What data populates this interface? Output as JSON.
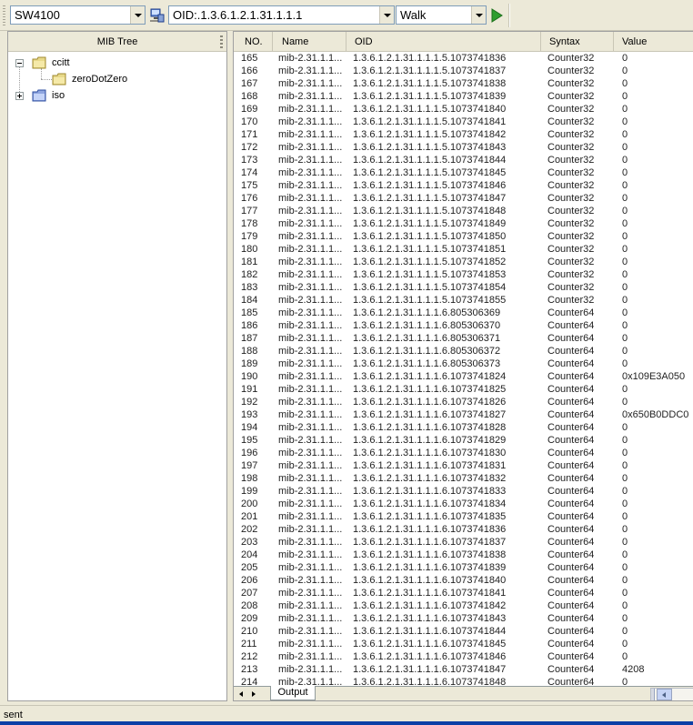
{
  "toolbar": {
    "device": "SW4100",
    "oid": "OID:.1.3.6.1.2.1.31.1.1.1",
    "operation": "Walk"
  },
  "mib_tree": {
    "title": "MIB Tree",
    "nodes": [
      {
        "label": "ccitt"
      },
      {
        "label": "zeroDotZero"
      },
      {
        "label": "iso"
      }
    ]
  },
  "grid": {
    "columns": [
      "NO.",
      "Name",
      "OID",
      "Syntax",
      "Value"
    ],
    "rows": [
      [
        "165",
        "mib-2.31.1.1...",
        "1.3.6.1.2.1.31.1.1.1.5.1073741836",
        "Counter32",
        "0"
      ],
      [
        "166",
        "mib-2.31.1.1...",
        "1.3.6.1.2.1.31.1.1.1.5.1073741837",
        "Counter32",
        "0"
      ],
      [
        "167",
        "mib-2.31.1.1...",
        "1.3.6.1.2.1.31.1.1.1.5.1073741838",
        "Counter32",
        "0"
      ],
      [
        "168",
        "mib-2.31.1.1...",
        "1.3.6.1.2.1.31.1.1.1.5.1073741839",
        "Counter32",
        "0"
      ],
      [
        "169",
        "mib-2.31.1.1...",
        "1.3.6.1.2.1.31.1.1.1.5.1073741840",
        "Counter32",
        "0"
      ],
      [
        "170",
        "mib-2.31.1.1...",
        "1.3.6.1.2.1.31.1.1.1.5.1073741841",
        "Counter32",
        "0"
      ],
      [
        "171",
        "mib-2.31.1.1...",
        "1.3.6.1.2.1.31.1.1.1.5.1073741842",
        "Counter32",
        "0"
      ],
      [
        "172",
        "mib-2.31.1.1...",
        "1.3.6.1.2.1.31.1.1.1.5.1073741843",
        "Counter32",
        "0"
      ],
      [
        "173",
        "mib-2.31.1.1...",
        "1.3.6.1.2.1.31.1.1.1.5.1073741844",
        "Counter32",
        "0"
      ],
      [
        "174",
        "mib-2.31.1.1...",
        "1.3.6.1.2.1.31.1.1.1.5.1073741845",
        "Counter32",
        "0"
      ],
      [
        "175",
        "mib-2.31.1.1...",
        "1.3.6.1.2.1.31.1.1.1.5.1073741846",
        "Counter32",
        "0"
      ],
      [
        "176",
        "mib-2.31.1.1...",
        "1.3.6.1.2.1.31.1.1.1.5.1073741847",
        "Counter32",
        "0"
      ],
      [
        "177",
        "mib-2.31.1.1...",
        "1.3.6.1.2.1.31.1.1.1.5.1073741848",
        "Counter32",
        "0"
      ],
      [
        "178",
        "mib-2.31.1.1...",
        "1.3.6.1.2.1.31.1.1.1.5.1073741849",
        "Counter32",
        "0"
      ],
      [
        "179",
        "mib-2.31.1.1...",
        "1.3.6.1.2.1.31.1.1.1.5.1073741850",
        "Counter32",
        "0"
      ],
      [
        "180",
        "mib-2.31.1.1...",
        "1.3.6.1.2.1.31.1.1.1.5.1073741851",
        "Counter32",
        "0"
      ],
      [
        "181",
        "mib-2.31.1.1...",
        "1.3.6.1.2.1.31.1.1.1.5.1073741852",
        "Counter32",
        "0"
      ],
      [
        "182",
        "mib-2.31.1.1...",
        "1.3.6.1.2.1.31.1.1.1.5.1073741853",
        "Counter32",
        "0"
      ],
      [
        "183",
        "mib-2.31.1.1...",
        "1.3.6.1.2.1.31.1.1.1.5.1073741854",
        "Counter32",
        "0"
      ],
      [
        "184",
        "mib-2.31.1.1...",
        "1.3.6.1.2.1.31.1.1.1.5.1073741855",
        "Counter32",
        "0"
      ],
      [
        "185",
        "mib-2.31.1.1...",
        "1.3.6.1.2.1.31.1.1.1.6.805306369",
        "Counter64",
        "0"
      ],
      [
        "186",
        "mib-2.31.1.1...",
        "1.3.6.1.2.1.31.1.1.1.6.805306370",
        "Counter64",
        "0"
      ],
      [
        "187",
        "mib-2.31.1.1...",
        "1.3.6.1.2.1.31.1.1.1.6.805306371",
        "Counter64",
        "0"
      ],
      [
        "188",
        "mib-2.31.1.1...",
        "1.3.6.1.2.1.31.1.1.1.6.805306372",
        "Counter64",
        "0"
      ],
      [
        "189",
        "mib-2.31.1.1...",
        "1.3.6.1.2.1.31.1.1.1.6.805306373",
        "Counter64",
        "0"
      ],
      [
        "190",
        "mib-2.31.1.1...",
        "1.3.6.1.2.1.31.1.1.1.6.1073741824",
        "Counter64",
        "0x109E3A050"
      ],
      [
        "191",
        "mib-2.31.1.1...",
        "1.3.6.1.2.1.31.1.1.1.6.1073741825",
        "Counter64",
        "0"
      ],
      [
        "192",
        "mib-2.31.1.1...",
        "1.3.6.1.2.1.31.1.1.1.6.1073741826",
        "Counter64",
        "0"
      ],
      [
        "193",
        "mib-2.31.1.1...",
        "1.3.6.1.2.1.31.1.1.1.6.1073741827",
        "Counter64",
        "0x650B0DDC0"
      ],
      [
        "194",
        "mib-2.31.1.1...",
        "1.3.6.1.2.1.31.1.1.1.6.1073741828",
        "Counter64",
        "0"
      ],
      [
        "195",
        "mib-2.31.1.1...",
        "1.3.6.1.2.1.31.1.1.1.6.1073741829",
        "Counter64",
        "0"
      ],
      [
        "196",
        "mib-2.31.1.1...",
        "1.3.6.1.2.1.31.1.1.1.6.1073741830",
        "Counter64",
        "0"
      ],
      [
        "197",
        "mib-2.31.1.1...",
        "1.3.6.1.2.1.31.1.1.1.6.1073741831",
        "Counter64",
        "0"
      ],
      [
        "198",
        "mib-2.31.1.1...",
        "1.3.6.1.2.1.31.1.1.1.6.1073741832",
        "Counter64",
        "0"
      ],
      [
        "199",
        "mib-2.31.1.1...",
        "1.3.6.1.2.1.31.1.1.1.6.1073741833",
        "Counter64",
        "0"
      ],
      [
        "200",
        "mib-2.31.1.1...",
        "1.3.6.1.2.1.31.1.1.1.6.1073741834",
        "Counter64",
        "0"
      ],
      [
        "201",
        "mib-2.31.1.1...",
        "1.3.6.1.2.1.31.1.1.1.6.1073741835",
        "Counter64",
        "0"
      ],
      [
        "202",
        "mib-2.31.1.1...",
        "1.3.6.1.2.1.31.1.1.1.6.1073741836",
        "Counter64",
        "0"
      ],
      [
        "203",
        "mib-2.31.1.1...",
        "1.3.6.1.2.1.31.1.1.1.6.1073741837",
        "Counter64",
        "0"
      ],
      [
        "204",
        "mib-2.31.1.1...",
        "1.3.6.1.2.1.31.1.1.1.6.1073741838",
        "Counter64",
        "0"
      ],
      [
        "205",
        "mib-2.31.1.1...",
        "1.3.6.1.2.1.31.1.1.1.6.1073741839",
        "Counter64",
        "0"
      ],
      [
        "206",
        "mib-2.31.1.1...",
        "1.3.6.1.2.1.31.1.1.1.6.1073741840",
        "Counter64",
        "0"
      ],
      [
        "207",
        "mib-2.31.1.1...",
        "1.3.6.1.2.1.31.1.1.1.6.1073741841",
        "Counter64",
        "0"
      ],
      [
        "208",
        "mib-2.31.1.1...",
        "1.3.6.1.2.1.31.1.1.1.6.1073741842",
        "Counter64",
        "0"
      ],
      [
        "209",
        "mib-2.31.1.1...",
        "1.3.6.1.2.1.31.1.1.1.6.1073741843",
        "Counter64",
        "0"
      ],
      [
        "210",
        "mib-2.31.1.1...",
        "1.3.6.1.2.1.31.1.1.1.6.1073741844",
        "Counter64",
        "0"
      ],
      [
        "211",
        "mib-2.31.1.1...",
        "1.3.6.1.2.1.31.1.1.1.6.1073741845",
        "Counter64",
        "0"
      ],
      [
        "212",
        "mib-2.31.1.1...",
        "1.3.6.1.2.1.31.1.1.1.6.1073741846",
        "Counter64",
        "0"
      ],
      [
        "213",
        "mib-2.31.1.1...",
        "1.3.6.1.2.1.31.1.1.1.6.1073741847",
        "Counter64",
        "4208"
      ],
      [
        "214",
        "mib-2.31.1.1...",
        "1.3.6.1.2.1.31.1.1.1.6.1073741848",
        "Counter64",
        "0"
      ]
    ]
  },
  "tabs": {
    "output": "Output"
  },
  "status": {
    "text": "sent"
  },
  "colors": {
    "accent": "#0c3fa6",
    "run_green": "#2e9e2e"
  },
  "icons": [
    "network-icon",
    "run-icon",
    "folder-icon"
  ]
}
